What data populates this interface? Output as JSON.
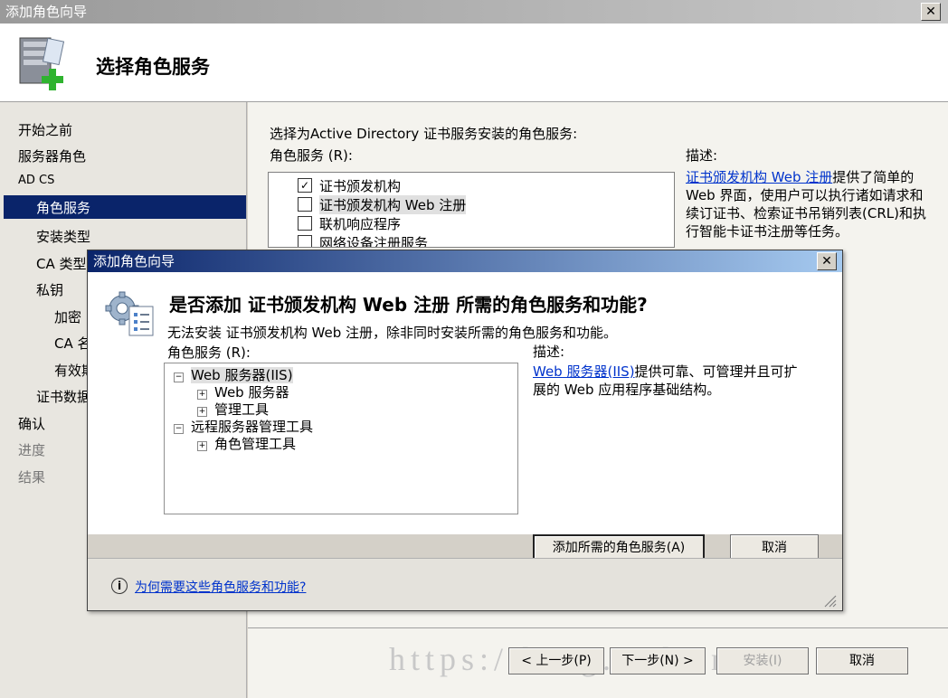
{
  "main": {
    "title": "添加角色向导",
    "close_glyph": "✕",
    "header_title": "选择角色服务",
    "nav": [
      {
        "label": "开始之前",
        "level": 0,
        "state": "normal"
      },
      {
        "label": "服务器角色",
        "level": 0,
        "state": "normal"
      },
      {
        "label": "AD CS",
        "level": 0,
        "state": "normal"
      },
      {
        "label": "角色服务",
        "level": 1,
        "state": "selected"
      },
      {
        "label": "安装类型",
        "level": 1,
        "state": "normal"
      },
      {
        "label": "CA 类型",
        "level": 1,
        "state": "normal"
      },
      {
        "label": "私钥",
        "level": 1,
        "state": "normal"
      },
      {
        "label": "加密",
        "level": 2,
        "state": "normal"
      },
      {
        "label": "CA 名称",
        "level": 2,
        "state": "normal"
      },
      {
        "label": "有效期",
        "level": 2,
        "state": "normal"
      },
      {
        "label": "证书数据库",
        "level": 1,
        "state": "normal"
      },
      {
        "label": "确认",
        "level": 0,
        "state": "normal"
      },
      {
        "label": "进度",
        "level": 0,
        "state": "disabled"
      },
      {
        "label": "结果",
        "level": 0,
        "state": "disabled"
      }
    ],
    "instruction": "选择为Active Directory 证书服务安装的角色服务:",
    "role_services_label": "角色服务 (R):",
    "role_services": [
      {
        "label": "证书颁发机构",
        "checked": true
      },
      {
        "label": "证书颁发机构 Web 注册",
        "checked": false
      },
      {
        "label": "联机响应程序",
        "checked": false
      },
      {
        "label": "网络设备注册服务",
        "checked": false
      }
    ],
    "description_label": "描述:",
    "description_link": "证书颁发机构 Web 注册",
    "description_text": "提供了简单的 Web 界面，使用户可以执行诸如请求和续订证书、检索证书吊销列表(CRL)和执行智能卡证书注册等任务。",
    "buttons": {
      "prev": "< 上一步(P)",
      "next": "下一步(N) >",
      "install": "安装(I)",
      "cancel": "取消"
    },
    "watermark": "https://blog.csdn.net/"
  },
  "dialog": {
    "title": "添加角色向导",
    "close_glyph": "✕",
    "question": "是否添加 证书颁发机构 Web 注册 所需的角色服务和功能?",
    "subtext": "无法安装 证书颁发机构 Web 注册，除非同时安装所需的角色服务和功能。",
    "role_services_label": "角色服务 (R):",
    "tree": [
      {
        "label": "Web 服务器(IIS)",
        "level": 0,
        "expander": "−"
      },
      {
        "label": "Web 服务器",
        "level": 1,
        "expander": "+"
      },
      {
        "label": "管理工具",
        "level": 1,
        "expander": "+"
      },
      {
        "label": "远程服务器管理工具",
        "level": 0,
        "expander": "−"
      },
      {
        "label": "角色管理工具",
        "level": 1,
        "expander": "+"
      }
    ],
    "description_label": "描述:",
    "description_link": "Web 服务器(IIS)",
    "description_text": "提供可靠、可管理并且可扩展的 Web 应用程序基础结构。",
    "add_button": "添加所需的角色服务(A)",
    "cancel_button": "取消",
    "help_link": "为何需要这些角色服务和功能?",
    "info_glyph": "i"
  },
  "colors": {
    "accent": "#0a246a",
    "link": "#0033cc"
  }
}
